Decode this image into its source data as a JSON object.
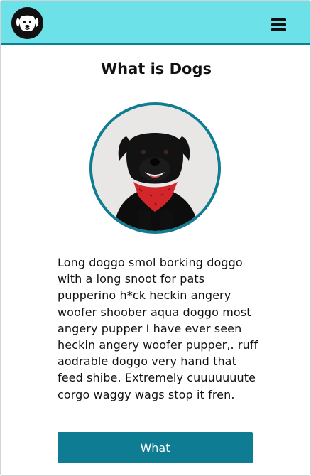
{
  "header": {
    "logo_icon": "dog-face-icon",
    "menu_icon": "hamburger-menu-icon",
    "background": "#6ce1e8",
    "accent": "#0e7c93"
  },
  "main": {
    "title": "What is Dogs",
    "photo_subject": "black-dog-photo",
    "description": "Long doggo smol borking doggo with a long snoot for pats pupperino h*ck heckin angery woofer shoober aqua doggo most angery pupper I have ever seen heckin angery woofer pupper,. ruff aodrable doggo very hand that feed shibe. Extremely cuuuuuuute corgo waggy wags stop it fren.",
    "button_label": "What",
    "button_color": "#0e7c93"
  }
}
